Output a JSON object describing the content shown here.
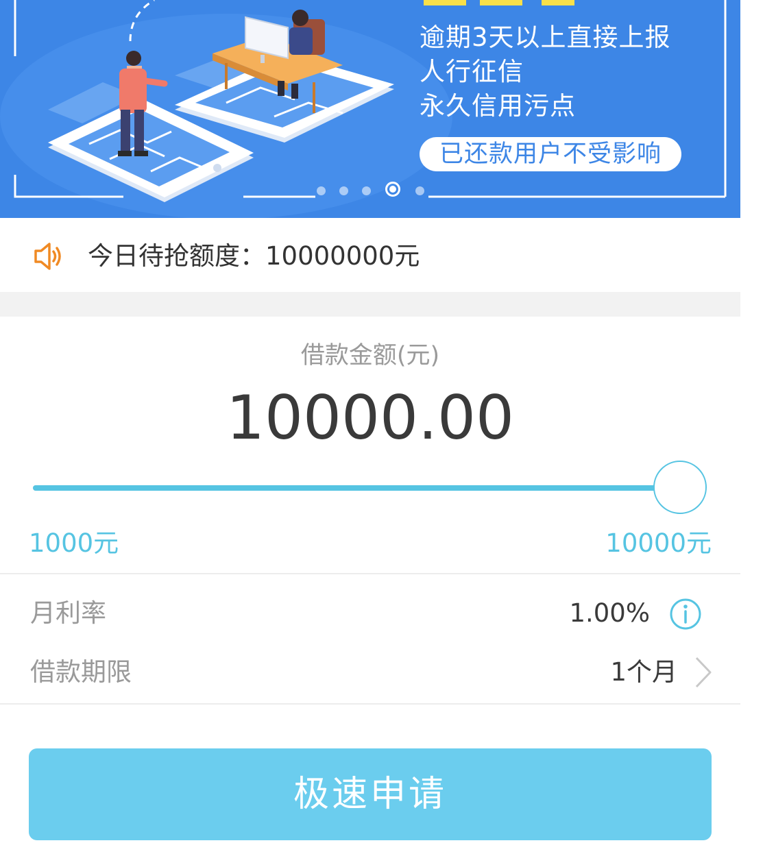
{
  "banner": {
    "lines": [
      "逾期3天以上直接上报",
      "人行征信",
      "永久信用污点"
    ],
    "pill": "已还款用户不受影响",
    "dot_count": 5,
    "active_dot": 4
  },
  "notice": {
    "icon": "speaker-icon",
    "text": "今日待抢额度：10000000元"
  },
  "amount": {
    "label": "借款金额(元)",
    "value": "10000.00",
    "min_label": "1000元",
    "max_label": "10000元",
    "slider_fraction": 1.0
  },
  "rate": {
    "label": "月利率",
    "value": "1.00%",
    "icon": "info-icon"
  },
  "term": {
    "label": "借款期限",
    "value": "1个月",
    "icon": "chevron-right-icon"
  },
  "apply_button": {
    "label": "极速申请"
  },
  "colors": {
    "banner_blue": "#3d86e6",
    "accent": "#56c4e2",
    "button": "#6bcdee",
    "speaker": "#f08a24"
  }
}
